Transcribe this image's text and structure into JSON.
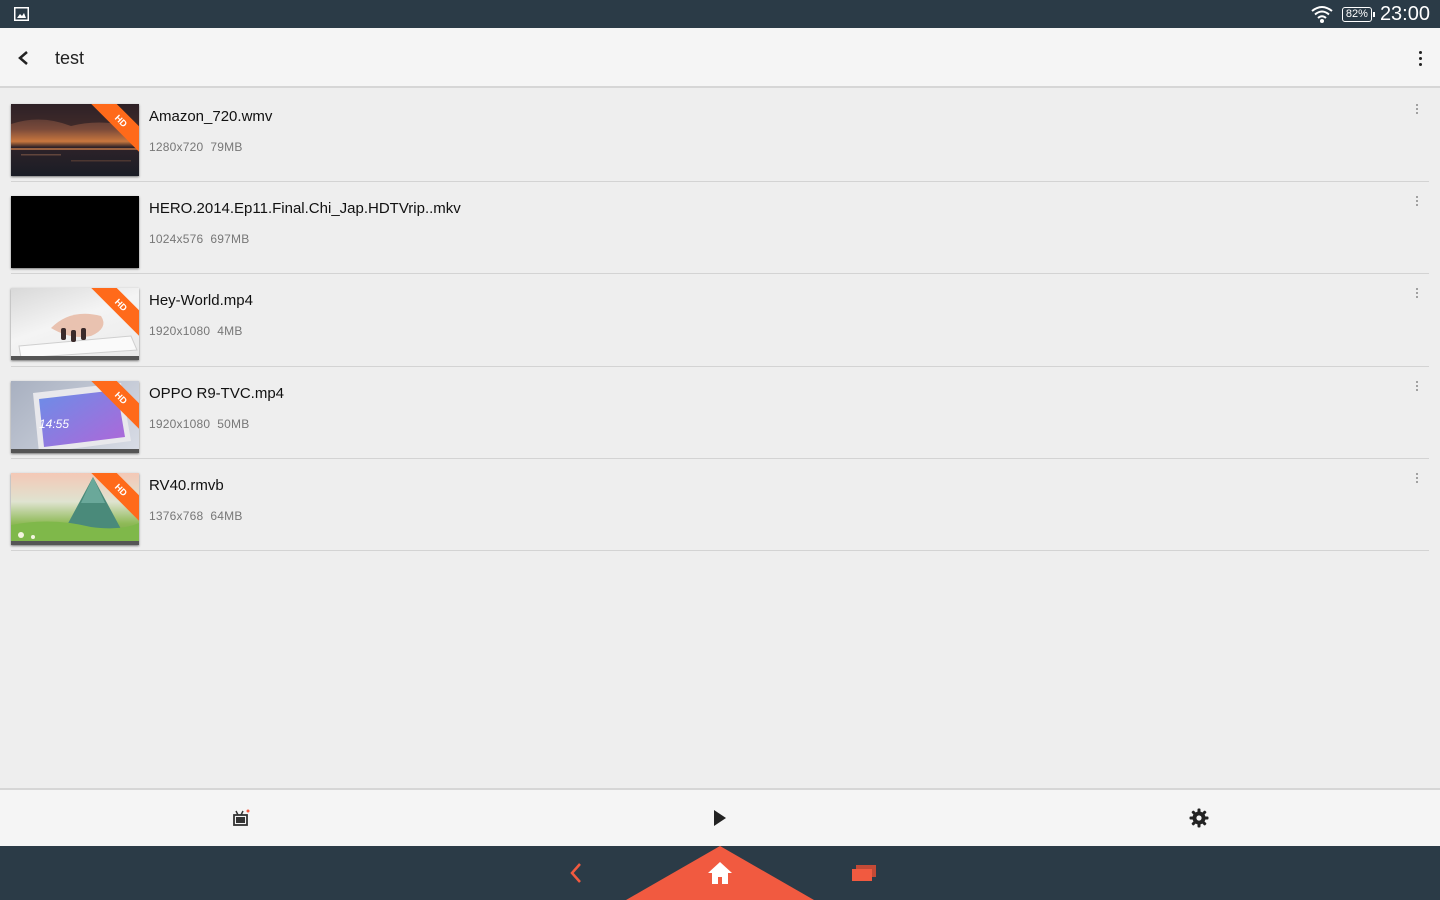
{
  "status_bar": {
    "battery": "82%",
    "time": "23:00"
  },
  "app_bar": {
    "title": "test"
  },
  "videos": [
    {
      "name": "Amazon_720.wmv",
      "resolution": "1280x720",
      "size": "79MB",
      "hd": true,
      "hd_label": "HD"
    },
    {
      "name": "HERO.2014.Ep11.Final.Chi_Jap.HDTVrip..mkv",
      "resolution": "1024x576",
      "size": "697MB",
      "hd": false
    },
    {
      "name": "Hey-World.mp4",
      "resolution": "1920x1080",
      "size": "4MB",
      "hd": true,
      "hd_label": "HD"
    },
    {
      "name": "OPPO R9-TVC.mp4",
      "resolution": "1920x1080",
      "size": "50MB",
      "hd": true,
      "hd_label": "HD",
      "thumb_text": "14:55"
    },
    {
      "name": "RV40.rmvb",
      "resolution": "1376x768",
      "size": "64MB",
      "hd": true,
      "hd_label": "HD"
    }
  ],
  "bottom_tabs": {
    "icons": [
      "tv-icon",
      "play-icon",
      "gear-icon"
    ]
  },
  "colors": {
    "status_bar": "#2b3b47",
    "accent": "#f15a40",
    "hd_badge": "#ff6a1a"
  }
}
